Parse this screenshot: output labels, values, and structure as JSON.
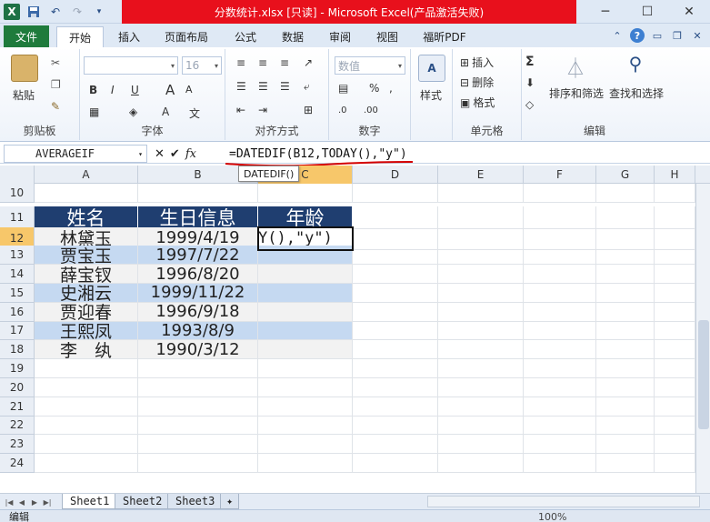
{
  "titlebar": {
    "title": "分数统计.xlsx  [只读]  -  Microsoft Excel(产品激活失败)",
    "app_icon": "X",
    "undo": "↶",
    "redo": "↷",
    "minimize": "─",
    "maximize": "☐",
    "close": "✕"
  },
  "tabs": {
    "file": "文件",
    "items": [
      "开始",
      "插入",
      "页面布局",
      "公式",
      "数据",
      "审阅",
      "视图",
      "福昕PDF"
    ],
    "active": "开始"
  },
  "ribbon": {
    "clipboard": {
      "paste": "粘贴",
      "label": "剪贴板"
    },
    "font": {
      "label": "字体",
      "size": "16",
      "bold": "B",
      "italic": "I",
      "underline": "U",
      "grow": "A",
      "shrink": "A"
    },
    "alignment": {
      "label": "对齐方式"
    },
    "number": {
      "label": "数字",
      "format": "数值",
      "percent": "%"
    },
    "styles": {
      "label": "样式",
      "button": "样式"
    },
    "cells": {
      "label": "单元格",
      "insert": "插入",
      "delete": "删除",
      "format": "格式"
    },
    "editing": {
      "label": "编辑",
      "sum": "Σ",
      "sort_filter": "排序和筛选",
      "find_select": "查找和选择"
    }
  },
  "formula_bar": {
    "name_box": "AVERAGEIF",
    "cancel": "✕",
    "enter": "✔",
    "fx": "fx",
    "formula": "=DATEDIF(B12,TODAY(),\"y\")",
    "tooltip": "DATEDIF()"
  },
  "grid": {
    "columns": [
      "A",
      "B",
      "C",
      "D",
      "E",
      "F",
      "G",
      "H"
    ],
    "selected_column": "C",
    "selected_row": "12",
    "rows": [
      {
        "num": "10",
        "cells": [
          "",
          "",
          ""
        ]
      },
      {
        "num": "11",
        "cells": [
          "姓名",
          "生日信息",
          "年龄"
        ]
      },
      {
        "num": "12",
        "cells": [
          "林黛玉",
          "1999/4/19",
          "Y(),\"y\")"
        ]
      },
      {
        "num": "13",
        "cells": [
          "贾宝玉",
          "1997/7/22",
          ""
        ]
      },
      {
        "num": "14",
        "cells": [
          "薛宝钗",
          "1996/8/20",
          ""
        ]
      },
      {
        "num": "15",
        "cells": [
          "史湘云",
          "1999/11/22",
          ""
        ]
      },
      {
        "num": "16",
        "cells": [
          "贾迎春",
          "1996/9/18",
          ""
        ]
      },
      {
        "num": "17",
        "cells": [
          "王熙凤",
          "1993/8/9",
          ""
        ]
      },
      {
        "num": "18",
        "cells": [
          "李　纨",
          "1990/3/12",
          ""
        ]
      },
      {
        "num": "19",
        "cells": [
          "",
          "",
          ""
        ]
      },
      {
        "num": "20",
        "cells": [
          "",
          "",
          ""
        ]
      },
      {
        "num": "21",
        "cells": [
          "",
          "",
          ""
        ]
      },
      {
        "num": "22",
        "cells": [
          "",
          "",
          ""
        ]
      },
      {
        "num": "23",
        "cells": [
          "",
          "",
          ""
        ]
      },
      {
        "num": "24",
        "cells": [
          "",
          "",
          ""
        ]
      }
    ]
  },
  "sheets": {
    "items": [
      "Sheet1",
      "Sheet2",
      "Sheet3"
    ],
    "active": "Sheet1"
  },
  "status": {
    "mode": "编辑",
    "zoom": "100%"
  },
  "colors": {
    "header_fill": "#1f3e70",
    "band_fill": "#c5d9f1",
    "title_red": "#e8101c",
    "file_green": "#1f7b3c"
  }
}
